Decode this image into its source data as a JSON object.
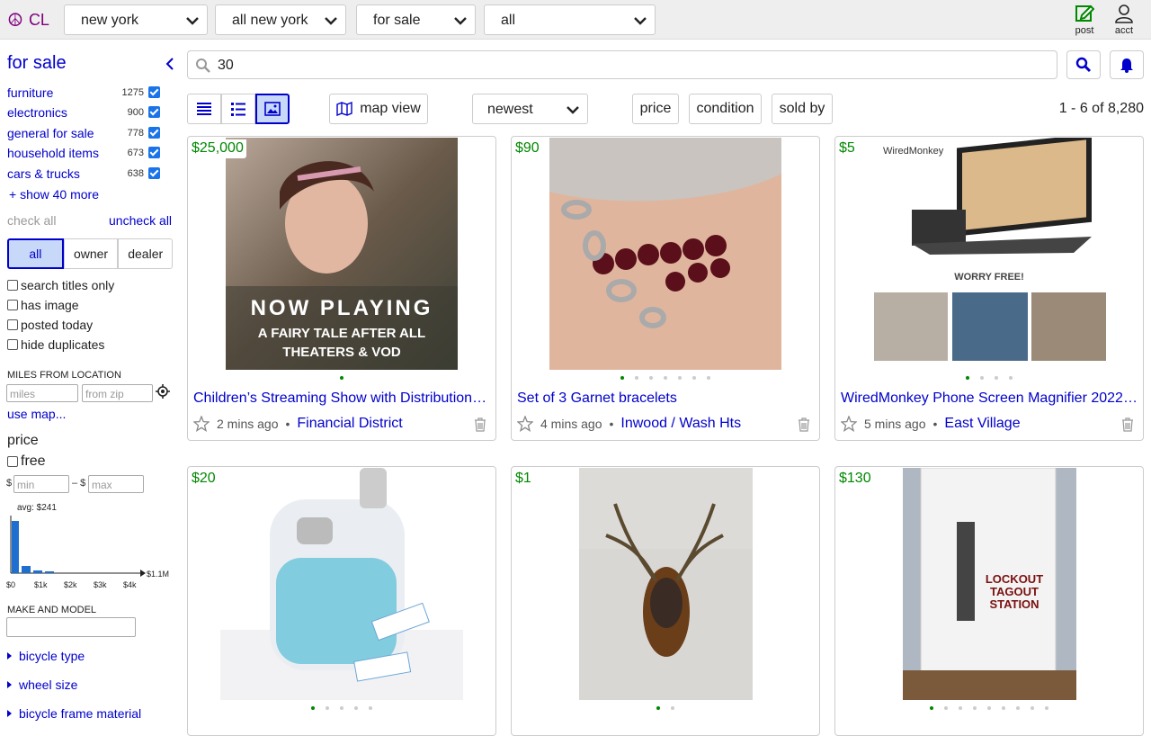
{
  "topbar": {
    "logo": "CL",
    "dropdowns": [
      "new york",
      "all new york",
      "for sale",
      "all"
    ],
    "post_label": "post",
    "acct_label": "acct"
  },
  "sidebar": {
    "title": "for sale",
    "categories": [
      {
        "label": "furniture",
        "count": "1275"
      },
      {
        "label": "electronics",
        "count": "900"
      },
      {
        "label": "general for sale",
        "count": "778"
      },
      {
        "label": "household items",
        "count": "673"
      },
      {
        "label": "cars & trucks",
        "count": "638"
      }
    ],
    "show_more": "+ show 40 more",
    "check_all": "check all",
    "uncheck_all": "uncheck all",
    "seller_tabs": [
      "all",
      "owner",
      "dealer"
    ],
    "options": [
      "search titles only",
      "has image",
      "posted today",
      "hide duplicates"
    ],
    "miles_label": "MILES FROM LOCATION",
    "miles_placeholder": "miles",
    "zip_placeholder": "from zip",
    "use_map": "use map...",
    "price_label": "price",
    "free_label": "free",
    "min_placeholder": "min",
    "max_placeholder": "max",
    "dollar": "$",
    "dash_dollar": "– $",
    "histogram": {
      "avg_label": "avg: $241",
      "ticks": [
        "$0",
        "$1k",
        "$2k",
        "$3k",
        "$4k"
      ],
      "max_label": "$1.1M"
    },
    "make_model_label": "MAKE AND MODEL",
    "filters": [
      "bicycle type",
      "wheel size",
      "bicycle frame material"
    ]
  },
  "search": {
    "query": "30"
  },
  "toolbar": {
    "map_view": "map view",
    "sort": "newest",
    "filters": [
      "price",
      "condition",
      "sold by"
    ],
    "range": "1 - 6 of 8,280"
  },
  "listings": [
    {
      "price": "$25,000",
      "title": "Children’s Streaming Show with Distribution…",
      "time": "2 mins ago",
      "location": "Financial District",
      "image_caption": [
        "NOW PLAYING",
        "A FAIRY TALE AFTER ALL",
        "THEATERS & VOD"
      ]
    },
    {
      "price": "$90",
      "title": "Set of 3 Garnet bracelets",
      "time": "4 mins ago",
      "location": "Inwood / Wash Hts"
    },
    {
      "price": "$5",
      "title": "WiredMonkey Phone Screen Magnifier 2022…",
      "time": "5 mins ago",
      "location": "East Village",
      "image_caption": [
        "WiredMonkey",
        "WORRY FREE!"
      ]
    },
    {
      "price": "$20",
      "title": "",
      "time": "",
      "location": ""
    },
    {
      "price": "$1",
      "title": "",
      "time": "",
      "location": ""
    },
    {
      "price": "$130",
      "title": "",
      "time": "",
      "location": "",
      "image_caption": [
        "LOCKOUT",
        "TAGOUT",
        "STATION"
      ]
    }
  ]
}
